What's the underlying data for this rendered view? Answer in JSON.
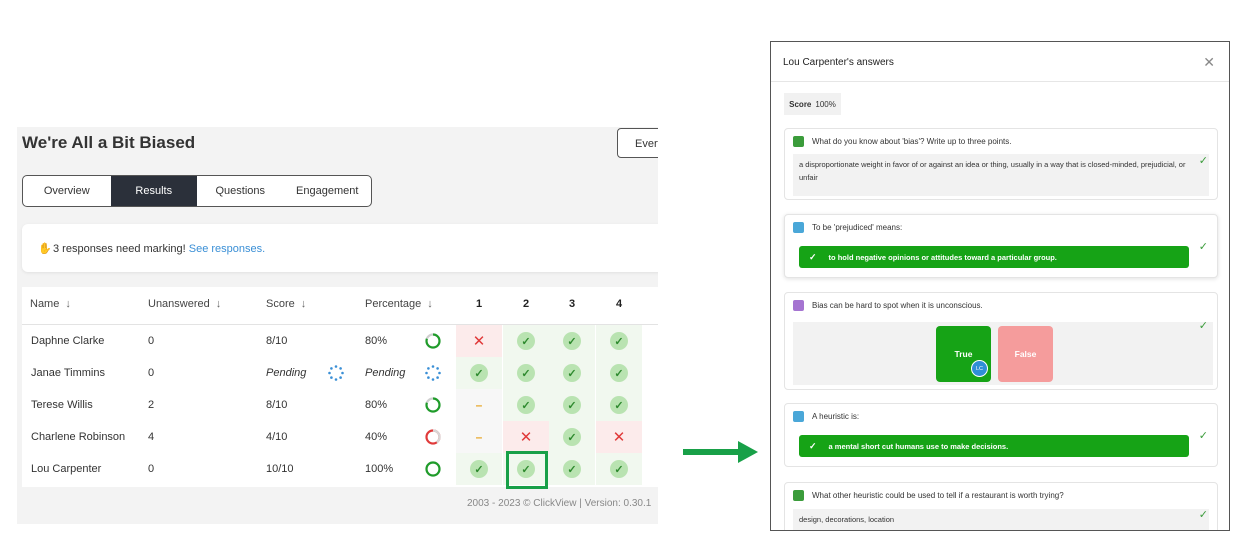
{
  "left": {
    "title": "We're All a Bit Biased",
    "every_button": "Every",
    "tabs": [
      "Overview",
      "Results",
      "Questions",
      "Engagement"
    ],
    "notice": {
      "text": "3 responses need marking!",
      "link": "See responses."
    },
    "columns": {
      "name": "Name",
      "unanswered": "Unanswered",
      "score": "Score",
      "percentage": "Percentage",
      "q": [
        "1",
        "2",
        "3",
        "4"
      ]
    },
    "rows": [
      {
        "name": "Daphne Clarke",
        "unanswered": "0",
        "score": "8/10",
        "percentage": "80%",
        "pct": 0.8,
        "marks": [
          "wrong",
          "right",
          "right",
          "right"
        ]
      },
      {
        "name": "Janae Timmins",
        "unanswered": "0",
        "score": "Pending",
        "percentage": "Pending",
        "pct": null,
        "marks": [
          "right",
          "right",
          "right",
          "right"
        ]
      },
      {
        "name": "Terese Willis",
        "unanswered": "2",
        "score": "8/10",
        "percentage": "80%",
        "pct": 0.8,
        "marks": [
          "unanswered",
          "right",
          "right",
          "right"
        ]
      },
      {
        "name": "Charlene Robinson",
        "unanswered": "4",
        "score": "4/10",
        "percentage": "40%",
        "pct": 0.4,
        "marks": [
          "unanswered",
          "wrong",
          "right",
          "wrong"
        ]
      },
      {
        "name": "Lou Carpenter",
        "unanswered": "0",
        "score": "10/10",
        "percentage": "100%",
        "pct": 1.0,
        "marks": [
          "right",
          "right",
          "right",
          "right"
        ]
      }
    ],
    "footer": "2003 - 2023 © ClickView | Version: 0.30.1"
  },
  "right": {
    "title": "Lou Carpenter's answers",
    "score_label": "Score",
    "score_value": "100%",
    "q1": {
      "question": "What do you know about 'bias'? Write up to three points.",
      "answer": "a disproportionate weight in favor of or against an idea or thing, usually in a way that is closed-minded, prejudicial, or unfair"
    },
    "q2": {
      "question": "To be 'prejudiced' means:",
      "answer": "to hold negative opinions or attitudes toward a particular group."
    },
    "q3": {
      "question": "Bias can be hard to spot when it is unconscious.",
      "true_label": "True",
      "false_label": "False",
      "avatar": "LC"
    },
    "q4": {
      "question": "A heuristic is:",
      "answer": "a mental short cut humans use to make decisions."
    },
    "q5": {
      "question": "What other heuristic could be used to tell if a restaurant is worth trying?",
      "answer": "design, decorations, location"
    }
  },
  "colors": {
    "accent_green": "#16a316",
    "arrow_green": "#18a048",
    "wrong_red": "#e03a3a",
    "pending_blue": "#3a8fd6",
    "tab_active": "#2b303a"
  },
  "icons": {
    "close": "close-icon",
    "sort": "arrow-down-icon",
    "check": "check-icon",
    "cross": "cross-icon",
    "hand": "waving-hand-icon"
  }
}
